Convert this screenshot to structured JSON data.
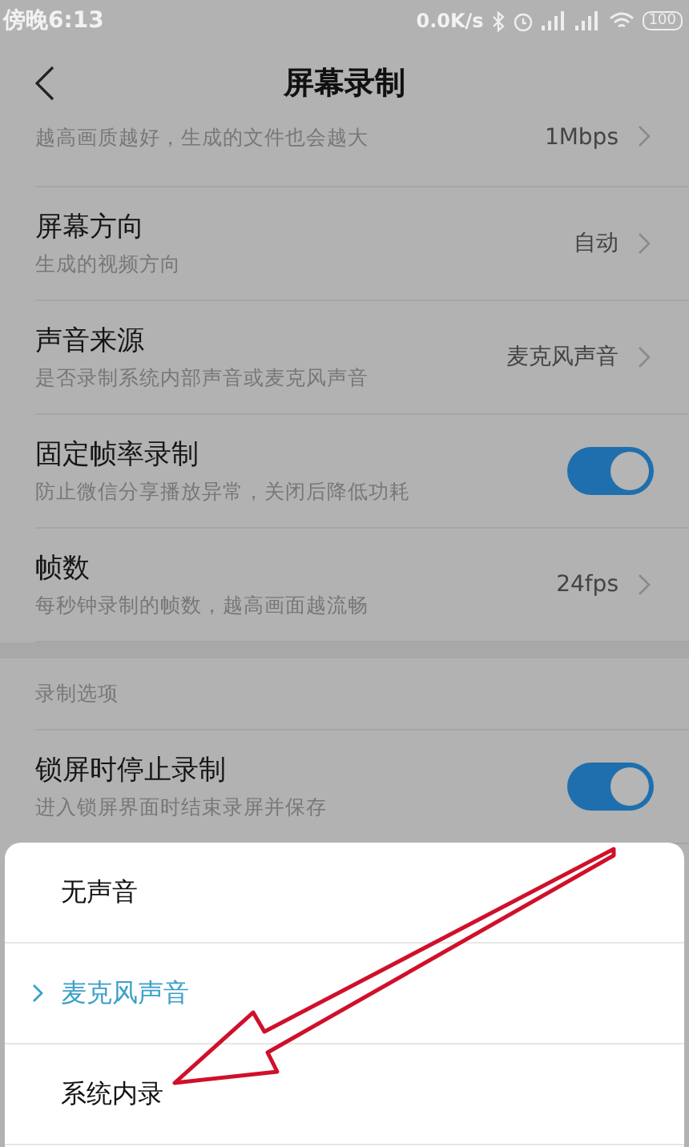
{
  "status_bar": {
    "time": "傍晚6:13",
    "speed": "0.0K/s",
    "battery": "100"
  },
  "header": {
    "title": "屏幕录制"
  },
  "settings": [
    {
      "kind": "partial",
      "subtitle": "越高画质越好，生成的文件也会越大",
      "value": "1Mbps"
    },
    {
      "kind": "value",
      "title": "屏幕方向",
      "subtitle": "生成的视频方向",
      "value": "自动"
    },
    {
      "kind": "value",
      "title": "声音来源",
      "subtitle": "是否录制系统内部声音或麦克风声音",
      "value": "麦克风声音"
    },
    {
      "kind": "toggle",
      "title": "固定帧率录制",
      "subtitle": "防止微信分享播放异常，关闭后降低功耗",
      "on": true
    },
    {
      "kind": "value",
      "title": "帧数",
      "subtitle": "每秒钟录制的帧数，越高画面越流畅",
      "value": "24fps"
    },
    {
      "kind": "section",
      "title": "录制选项"
    },
    {
      "kind": "toggle",
      "title": "锁屏时停止录制",
      "subtitle": "进入锁屏界面时结束录屏并保存",
      "on": true
    }
  ],
  "sheet": {
    "options": [
      {
        "label": "无声音",
        "selected": false
      },
      {
        "label": "麦克风声音",
        "selected": true
      },
      {
        "label": "系统内录",
        "selected": false
      }
    ]
  }
}
